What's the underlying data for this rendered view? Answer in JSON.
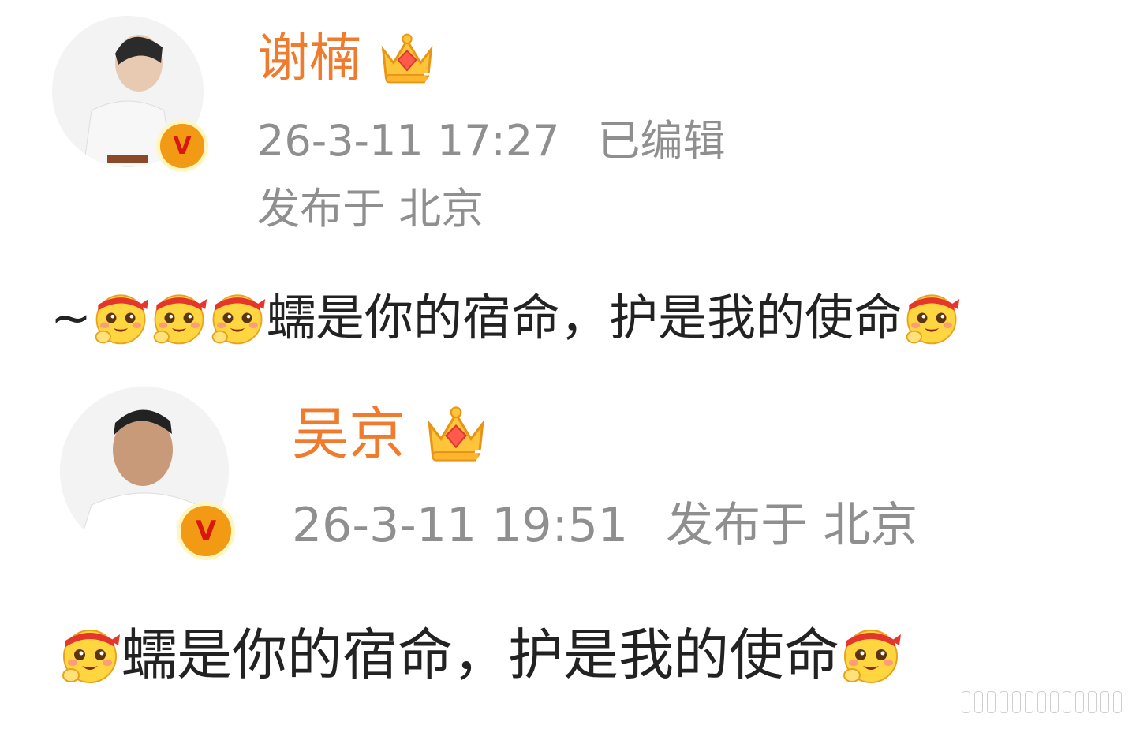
{
  "posts": [
    {
      "username": "谢楠",
      "timestamp": "26-3-11 17:27",
      "edited": "已编辑",
      "location": "发布于 北京",
      "text_prefix": "~",
      "text": "蠕是你的宿命，护是我的使命",
      "crown_level": "7",
      "verified_icon": "v-badge-icon",
      "emoji_icon": "headband-smiley-emoji"
    },
    {
      "username": "吴京",
      "timestamp": "26-3-11 19:51",
      "location": "发布于 北京",
      "text": "蠕是你的宿命，护是我的使命",
      "crown_level": "7",
      "verified_icon": "v-badge-icon",
      "emoji_icon": "headband-smiley-emoji"
    }
  ],
  "verified_letter": "V",
  "colors": {
    "username": "#f07b2c",
    "meta": "#8f8f8f",
    "body": "#222222",
    "badge": "#f39a15"
  }
}
